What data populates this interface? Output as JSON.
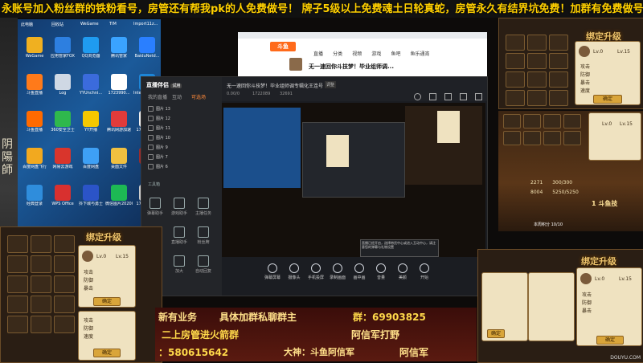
{
  "marquee": {
    "text": "永账号加入粉丝群的铁粉看号，房管还有帮我pk的人免费做号！ 牌子5级以上免费魂土日轮真蛇，房管永久有结界坑免费！加群有免费做号福利"
  },
  "left_art": {
    "text": "阴陽師"
  },
  "desktop": {
    "top_labels": [
      "此电脑",
      "回收站",
      "WeGame",
      "TIM",
      "Import11z..."
    ],
    "icons": [
      {
        "label": "WeGame",
        "color": "#f0b020"
      },
      {
        "label": "应用管家FOX",
        "color": "#2d7fe0"
      },
      {
        "label": "QQ浏览器",
        "color": "#1f9bf0"
      },
      {
        "label": "腾讯管家",
        "color": "#3aa3ff"
      },
      {
        "label": "BaiduNetd...",
        "color": "#2a7fff"
      },
      {
        "label": "斗鱼直播",
        "color": "#ff7a1a"
      },
      {
        "label": "Log",
        "color": "#cfd8e4"
      },
      {
        "label": "YYUnchni...",
        "color": "#3b6bdc"
      },
      {
        "label": "1723990...",
        "color": "#ffffff"
      },
      {
        "label": "Internet Explorer",
        "color": "#1d86d8"
      },
      {
        "label": "斗鱼直播",
        "color": "#ff6a00"
      },
      {
        "label": "360安全卫士",
        "color": "#2fb84d"
      },
      {
        "label": "YY开播",
        "color": "#f5c800"
      },
      {
        "label": "腾讯网游加速",
        "color": "#e13b3b"
      },
      {
        "label": "1723990...",
        "color": "#eeeeee"
      },
      {
        "label": "百度网盘飞行",
        "color": "#f2a91f"
      },
      {
        "label": "网易云游戏",
        "color": "#d9352c"
      },
      {
        "label": "百度网盘",
        "color": "#3ea0f5"
      },
      {
        "label": "桌面文件",
        "color": "#f0c040"
      },
      {
        "label": "阴阳师",
        "color": "#9a2c2c"
      },
      {
        "label": "经典登录",
        "color": "#2f8ddc"
      },
      {
        "label": "WPS Office",
        "color": "#d8302f"
      },
      {
        "label": "抖下城与勇士",
        "color": "#2b54c8"
      },
      {
        "label": "微信图片2020091...",
        "color": "#1db954"
      },
      {
        "label": "1723990...",
        "color": "#cccccc"
      }
    ]
  },
  "browser": {
    "logo": "斗鱼",
    "nav": [
      "直播",
      "分类",
      "视频",
      "游戏",
      "鱼吧",
      "鱼乐通宵"
    ],
    "room_title": "无一速回你斗技梦！毕业组师调..."
  },
  "app": {
    "logo": "直播伴侣",
    "badge": "试用",
    "title": "无一速回你斗技梦！毕业组师调专辑化王连号",
    "title_tag": "调整",
    "left_tabs": [
      "我的直播",
      "互动",
      "可选场"
    ],
    "scene_items": [
      "图片 13",
      "图片 12",
      "图片 11",
      "图片 10",
      "图片 9",
      "图片 7",
      "图片 6"
    ],
    "scene_footer": "工具箱",
    "side_tools": [
      {
        "label": "弹幕助手"
      },
      {
        "label": "游戏助手"
      },
      {
        "label": "主播任务"
      },
      {
        "label": "派礼物"
      },
      {
        "label": "直播助手"
      },
      {
        "label": "粉丝牌"
      },
      {
        "label": "抽奖机"
      },
      {
        "label": "加大"
      },
      {
        "label": "自动回复"
      }
    ],
    "stats": [
      "0.00/0",
      "1722089",
      "32691"
    ],
    "bottom_tools": [
      {
        "label": "弹幕屏幕"
      },
      {
        "label": "摄像头"
      },
      {
        "label": "手机投屏"
      },
      {
        "label": "录制画面"
      },
      {
        "label": "画中画"
      },
      {
        "label": "音量"
      },
      {
        "label": "美颜"
      },
      {
        "label": "开始"
      }
    ],
    "notice": "直播已经开启，选择带货中心或进入互动中心，请注意您的弹幕与礼物设置"
  },
  "game": {
    "panel_title": "绑定升级",
    "cards": [
      {
        "lv_from": "Lv.0",
        "lv_to": "Lv.15",
        "btn": "确定"
      },
      {
        "lv_from": "Lv.0",
        "lv_to": "Lv.15",
        "btn": "确定"
      },
      {
        "lv_from": "Lv.0",
        "lv_to": "Lv.15",
        "btn": "确定"
      }
    ],
    "stat_rows": [
      "攻击",
      "防御",
      "暴击",
      "速度"
    ],
    "right_stats": [
      {
        "label": "2271",
        "value": "300/300"
      },
      {
        "label": "8004",
        "value": "5250/5250"
      }
    ],
    "battle_title": "1 斗鱼技",
    "page_badge": "本周积分 10/10",
    "watermark": "DOUYU.COM"
  },
  "promo": {
    "line1_a": "新有业务",
    "line1_b": "具体加群私聊群主",
    "line1_c": "群：69903825",
    "line2_a": "二上房管进火箭群",
    "line2_b": "阿信军打野",
    "line3_a": "：580615642",
    "line3_b": "大神：斗鱼阿信军",
    "line3_c": "阿信军"
  }
}
